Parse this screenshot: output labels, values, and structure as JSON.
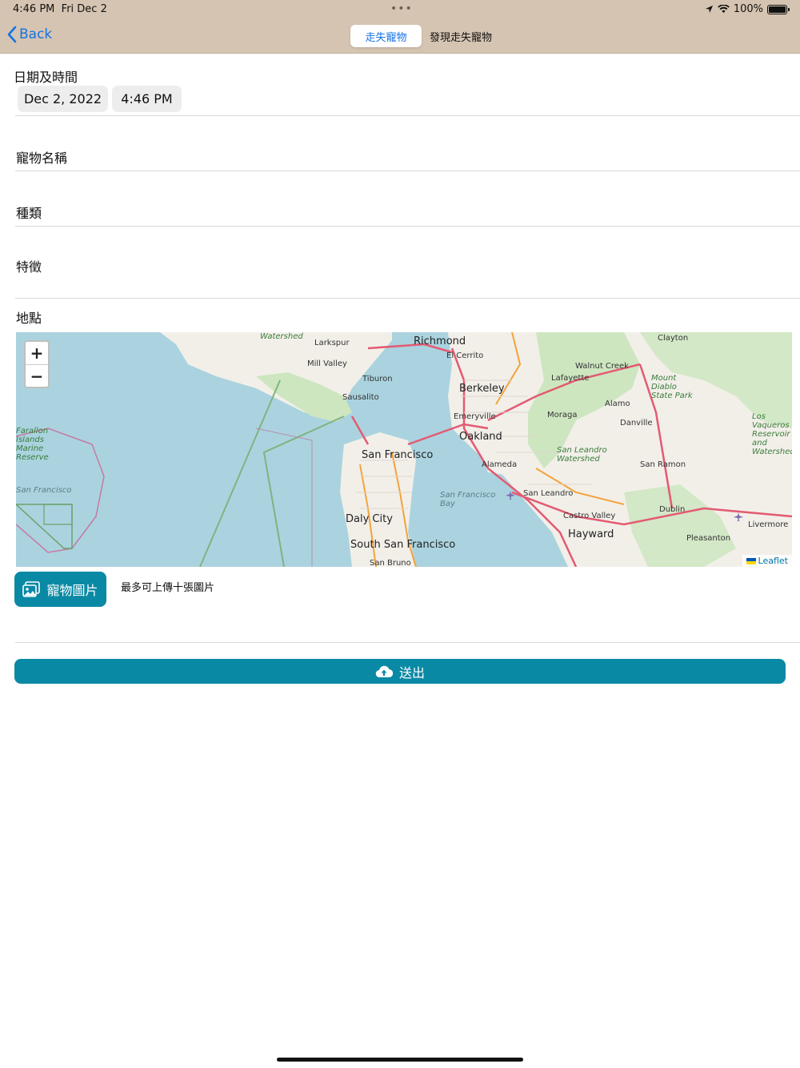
{
  "status_bar": {
    "time": "4:46 PM",
    "date": "Fri Dec 2",
    "dots": "•••",
    "battery": "100%",
    "battery_level": 1.0
  },
  "nav": {
    "back_label": "Back",
    "segments": [
      {
        "label": "走失寵物",
        "active": true
      },
      {
        "label": "發現走失寵物",
        "active": false
      }
    ]
  },
  "form": {
    "datetime_label": "日期及時間",
    "date_value": "Dec 2, 2022",
    "time_value": "4:46 PM",
    "pet_name_label": "寵物名稱",
    "species_label": "種類",
    "features_label": "特徵",
    "location_label": "地點"
  },
  "map": {
    "zoom_in": "+",
    "zoom_out": "−",
    "attribution": "Leaflet",
    "places": [
      "Richmond",
      "El Cerrito",
      "Berkeley",
      "Emeryville",
      "Oakland",
      "San Francisco",
      "Daly City",
      "South San Francisco",
      "San Bruno",
      "Alameda",
      "San Leandro",
      "Castro Valley",
      "Hayward",
      "Dublin",
      "Pleasanton",
      "Livermore",
      "San Ramon",
      "Danville",
      "Alamo",
      "Moraga",
      "Lafayette",
      "Walnut Creek",
      "Clayton",
      "Larkspur",
      "Mill Valley",
      "Tiburon",
      "Sausalito"
    ],
    "parks": [
      "Mount Diablo State Park",
      "San Leandro Watershed",
      "Watershed",
      "Los Vaqueros Reservoir and Watershed",
      "Farallon Islands Marine Reserve"
    ],
    "waters": [
      "San Francisco Bay",
      "San Francisco"
    ]
  },
  "photo": {
    "button_label": "寵物圖片",
    "hint": "最多可上傳十張圖片"
  },
  "submit_label": "送出",
  "colors": {
    "accent": "#0a89a5",
    "link": "#1473e6",
    "topbar": "#d5c4b1",
    "water": "#aad3df",
    "land": "#f2efe9",
    "park": "#cde6c0"
  }
}
